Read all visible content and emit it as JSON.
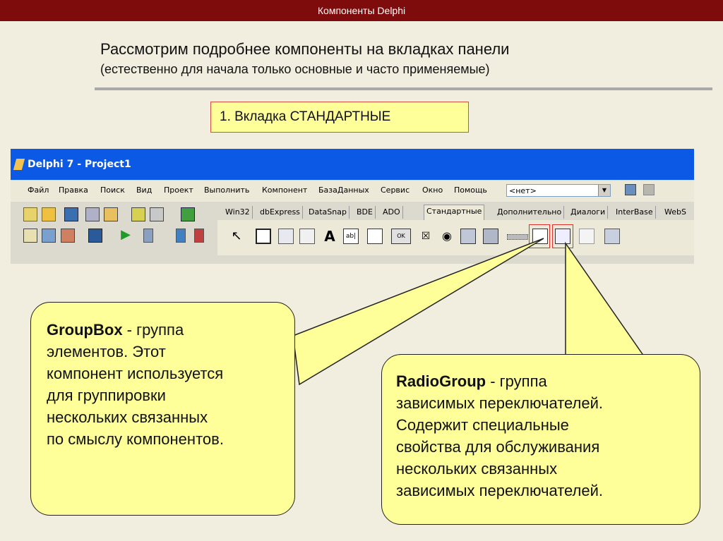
{
  "top_title": "Компоненты Delphi",
  "heading": {
    "line1": "Рассмотрим подробнее компоненты на вкладках панели",
    "line2": "(естественно для начала только основные и часто применяемые)"
  },
  "tab_note": "1. Вкладка СТАНДАРТНЫЕ",
  "ide": {
    "window_title": "Delphi 7 - Project1",
    "menu": [
      "Файл",
      "Правка",
      "Поиск",
      "Вид",
      "Проект",
      "Выполнить",
      "Компонент",
      "БазаДанных",
      "Сервис",
      "Окно",
      "Помощь"
    ],
    "combo_value": "<нет>",
    "tabs": [
      "Win32",
      "dbExpress",
      "DataSnap",
      "BDE",
      "ADO",
      "Стандартные",
      "Дополнительно",
      "Диалоги",
      "InterBase",
      "WebS"
    ],
    "active_tab": "Стандартные"
  },
  "callouts": {
    "groupbox": {
      "title": "GroupBox",
      "dash": " - группа",
      "lines": [
        "элементов. Этот",
        "компонент используется",
        "для группировки",
        "нескольких связанных",
        "по смыслу компонентов."
      ]
    },
    "radiogroup": {
      "title": "RadioGroup",
      "dash": " - группа",
      "lines": [
        "зависимых переключателей.",
        "Содержит специальные",
        "свойства для обслуживания",
        "нескольких связанных",
        "зависимых переключателей."
      ]
    }
  },
  "colors": {
    "top_bar": "#7f0c0c",
    "background": "#f2eedf",
    "callout_fill": "#ffff99",
    "highlight": "#e03030",
    "xp_title": "#0c59e6"
  }
}
